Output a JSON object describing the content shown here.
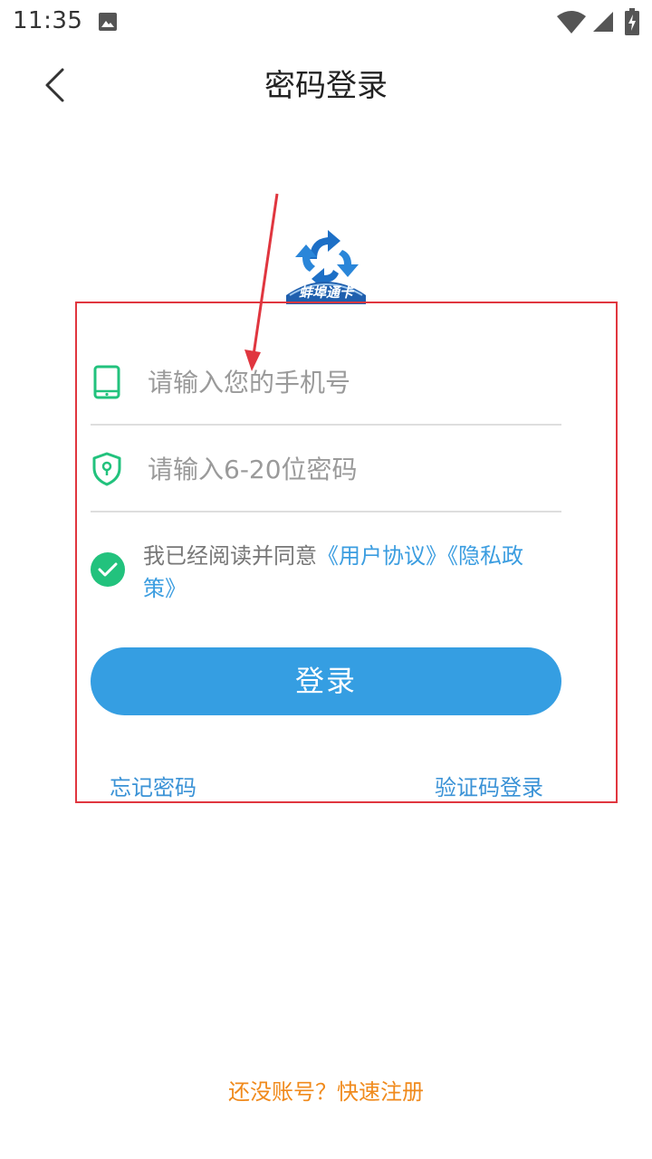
{
  "status_bar": {
    "time": "11:35"
  },
  "nav": {
    "title": "密码登录"
  },
  "logo": {
    "text": "蚌埠通卡"
  },
  "form": {
    "phone_placeholder": "请输入您的手机号",
    "password_placeholder": "请输入6-20位密码",
    "agreement_prefix": "我已经阅读并同意",
    "user_agreement": "《用户协议》",
    "privacy_policy": "《隐私政策》",
    "agreement_checked": true,
    "login_label": "登录",
    "forgot_password": "忘记密码",
    "sms_login": "验证码登录"
  },
  "footer": {
    "register_text": "还没账号？快速注册"
  },
  "colors": {
    "accent": "#359ee2",
    "check": "#22c27d",
    "register": "#f08a1c",
    "annotation": "#e0363f"
  }
}
